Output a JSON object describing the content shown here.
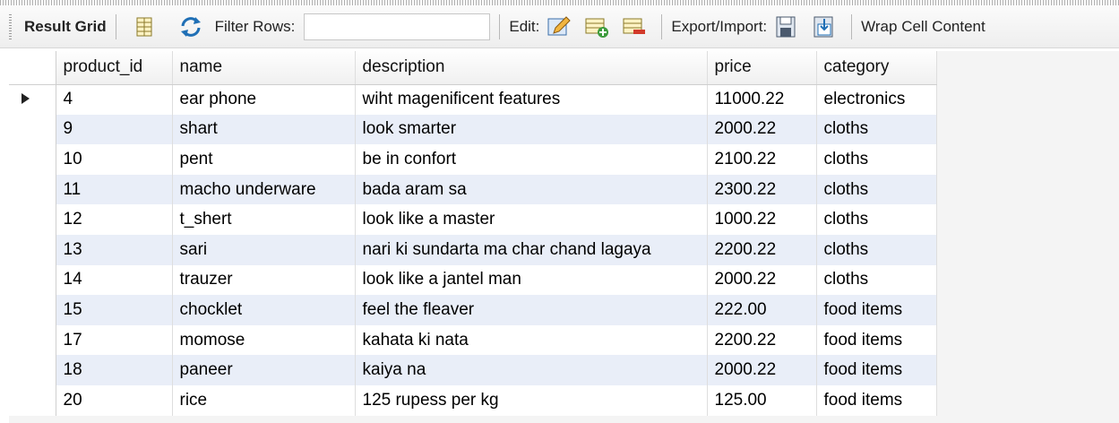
{
  "toolbar": {
    "result_grid": "Result Grid",
    "filter_rows": "Filter Rows:",
    "filter_value": "",
    "edit": "Edit:",
    "export_import": "Export/Import:",
    "wrap_cell": "Wrap Cell Content"
  },
  "colors": {
    "accent": "#1f6fb5",
    "alt_row": "#e9eef8"
  },
  "columns": [
    "product_id",
    "name",
    "description",
    "price",
    "category"
  ],
  "rows": [
    [
      "4",
      "ear phone",
      "wiht magenificent features",
      "11000.22",
      "electronics"
    ],
    [
      "9",
      "shart",
      "look smarter",
      "2000.22",
      "cloths"
    ],
    [
      "10",
      "pent",
      "be in confort",
      "2100.22",
      "cloths"
    ],
    [
      "11",
      "macho underware",
      "bada aram sa",
      "2300.22",
      "cloths"
    ],
    [
      "12",
      "t_shert",
      "look like a master",
      "1000.22",
      "cloths"
    ],
    [
      "13",
      "sari",
      "nari ki sundarta ma char chand lagaya",
      "2200.22",
      "cloths"
    ],
    [
      "14",
      "trauzer",
      "look like a jantel man",
      "2000.22",
      "cloths"
    ],
    [
      "15",
      "chocklet",
      "feel the fleaver",
      "222.00",
      "food items"
    ],
    [
      "17",
      "momose",
      "kahata ki nata",
      "2200.22",
      "food items"
    ],
    [
      "18",
      "paneer",
      "kaiya na",
      "2000.22",
      "food items"
    ],
    [
      "20",
      "rice",
      "125 rupess per kg",
      "125.00",
      "food items"
    ]
  ]
}
